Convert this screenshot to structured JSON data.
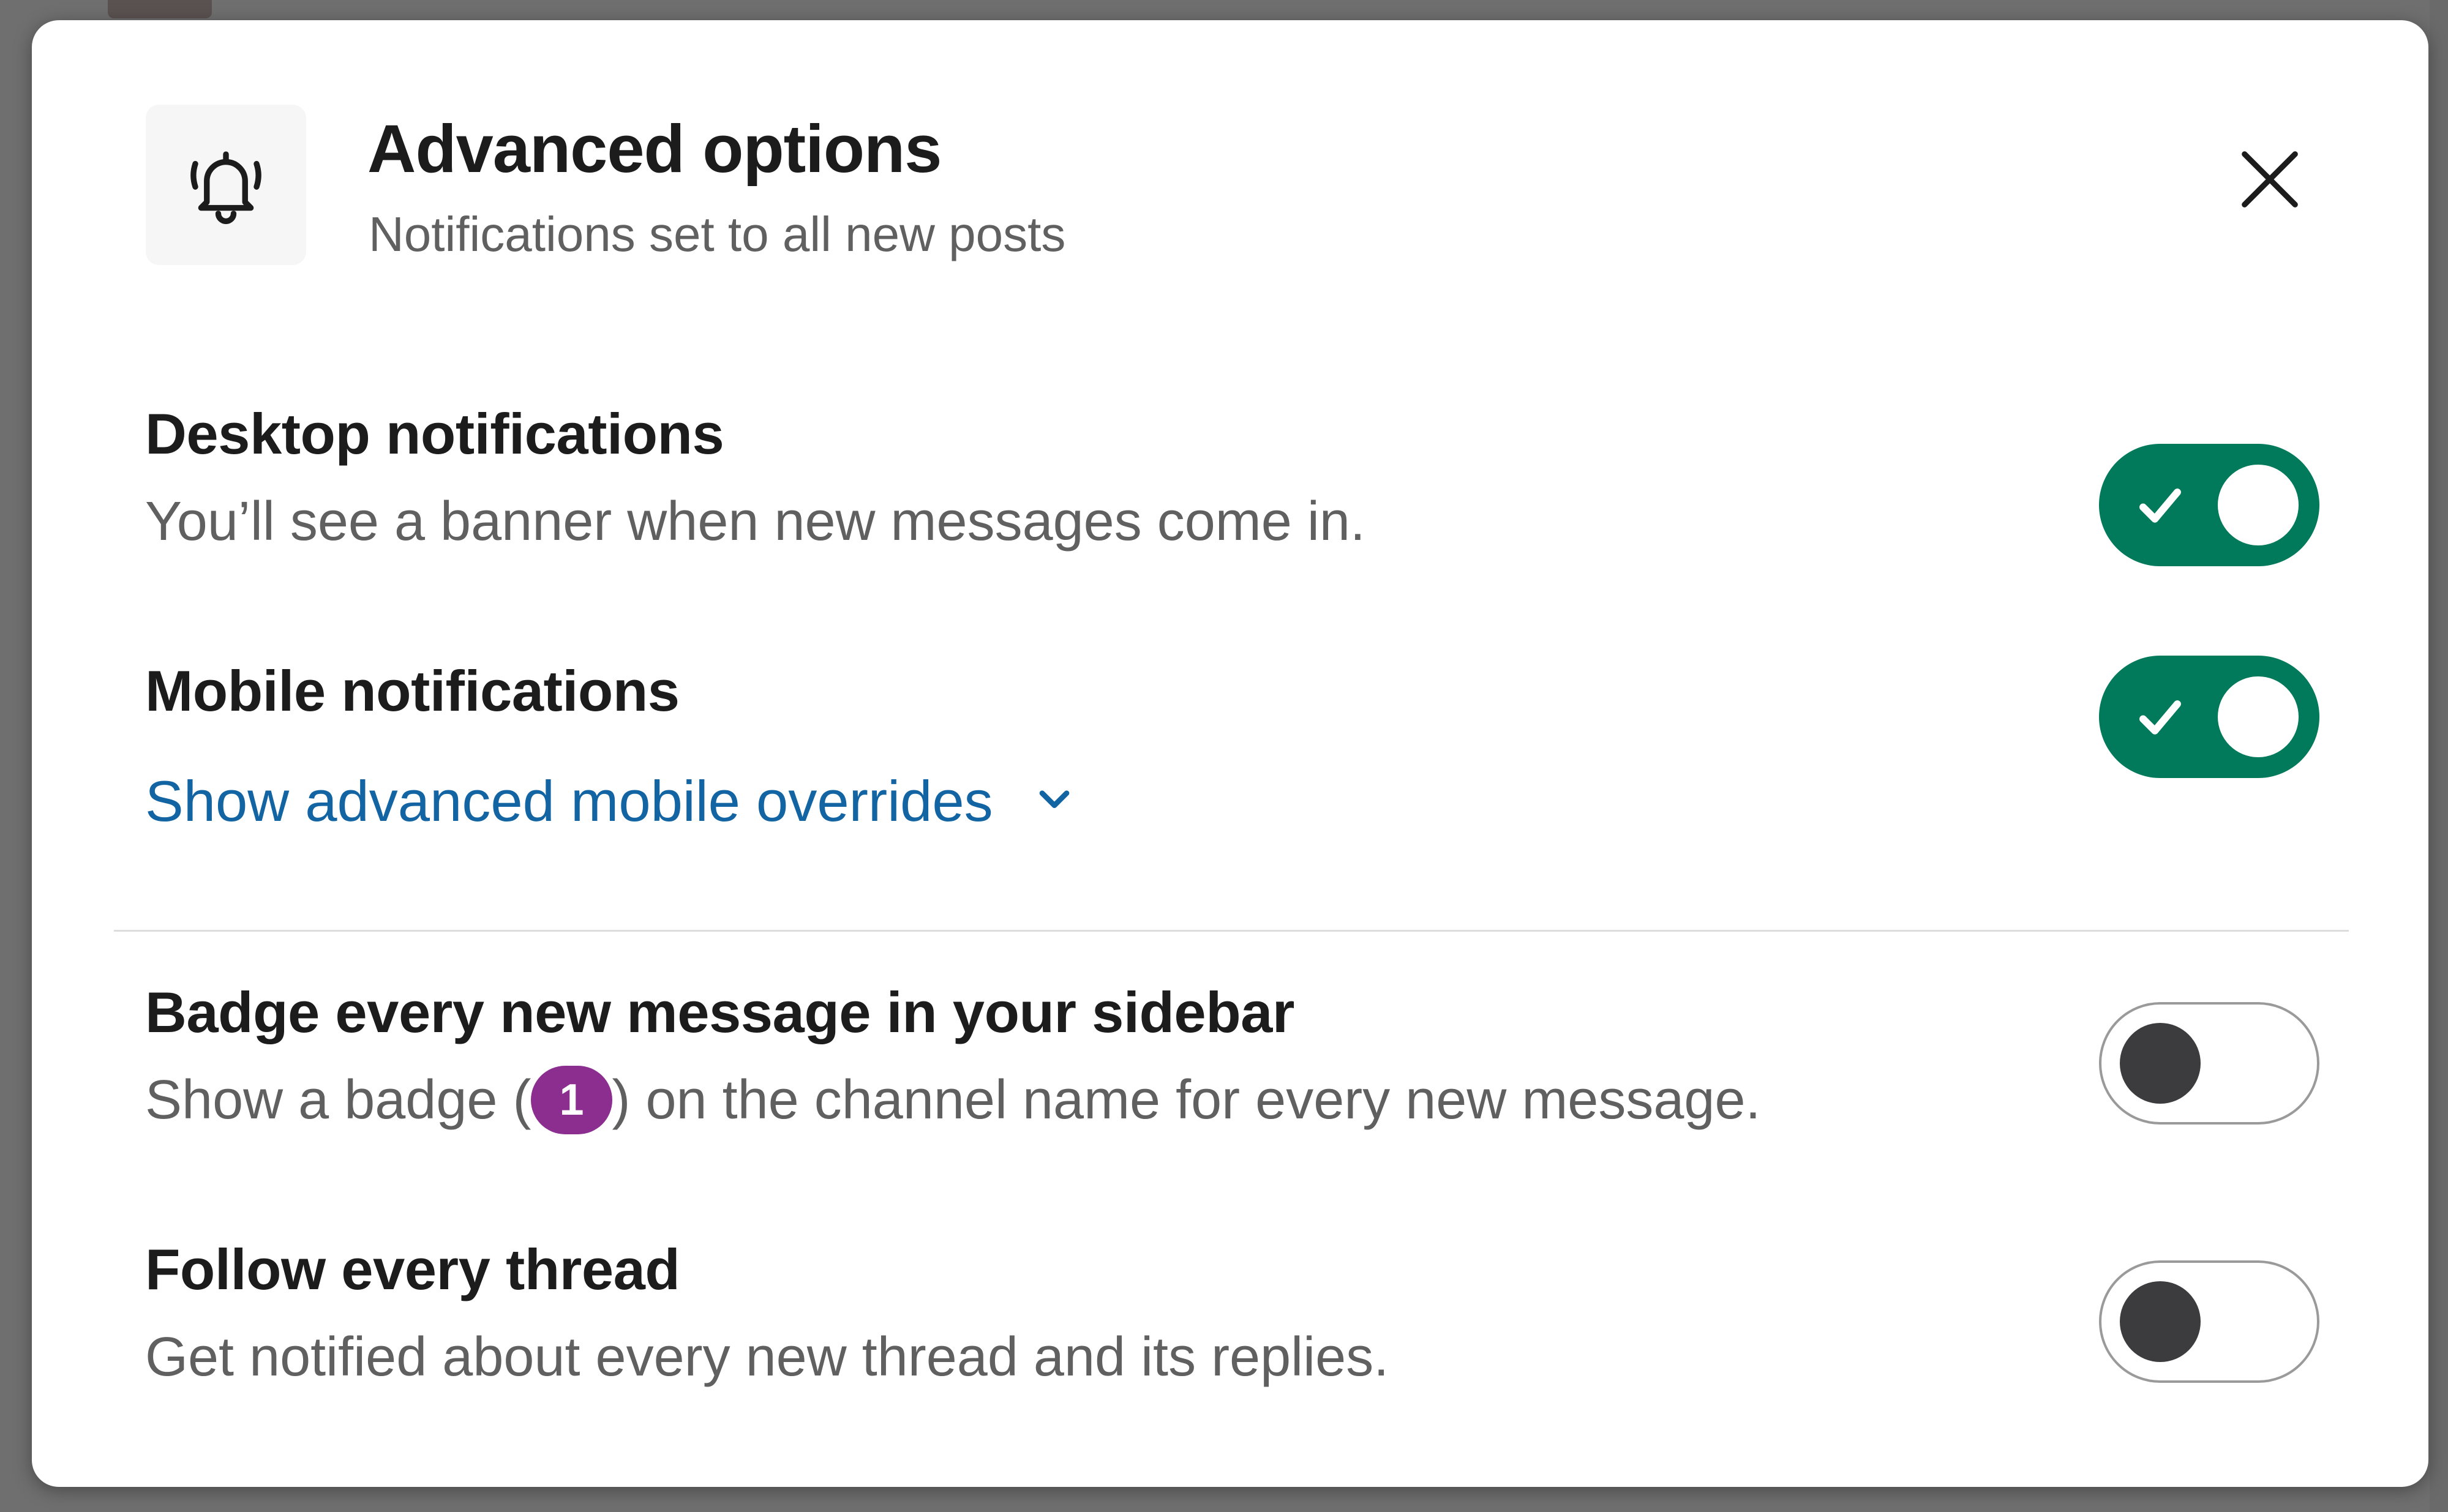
{
  "modal": {
    "title": "Advanced options",
    "subtitle": "Notifications set to all new posts",
    "header_icon": "bell-icon",
    "close_icon": "close-icon"
  },
  "settings": [
    {
      "title": "Desktop notifications",
      "description": "You’ll see a banner when new messages come in.",
      "enabled": true
    },
    {
      "title": "Mobile notifications",
      "link": "Show advanced mobile overrides",
      "enabled": true
    },
    {
      "title": "Badge every new message in your sidebar",
      "description_before": "Show a badge (",
      "badge": "1",
      "description_after": ") on the channel name for every new message.",
      "enabled": false
    },
    {
      "title": "Follow every thread",
      "description": "Get notified about every new thread and its replies.",
      "enabled": false
    }
  ],
  "colors": {
    "toggle_on": "#007a5a",
    "link": "#1264a3",
    "badge": "#8b2e8f",
    "toggle_off_knob": "#3c3c3e"
  }
}
